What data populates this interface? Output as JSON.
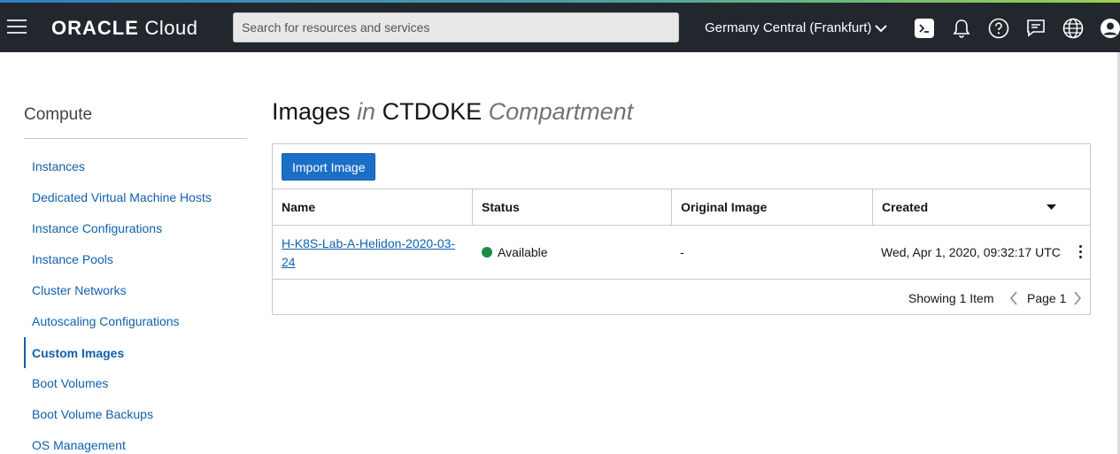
{
  "header": {
    "brand_bold": "ORACLE",
    "brand_light": "Cloud",
    "search_placeholder": "Search for resources and services",
    "region": "Germany Central (Frankfurt)"
  },
  "sidebar": {
    "title": "Compute",
    "items": [
      {
        "label": "Instances"
      },
      {
        "label": "Dedicated Virtual Machine Hosts"
      },
      {
        "label": "Instance Configurations"
      },
      {
        "label": "Instance Pools"
      },
      {
        "label": "Cluster Networks"
      },
      {
        "label": "Autoscaling Configurations"
      },
      {
        "label": "Custom Images",
        "active": true
      },
      {
        "label": "Boot Volumes"
      },
      {
        "label": "Boot Volume Backups"
      },
      {
        "label": "OS Management"
      }
    ]
  },
  "main": {
    "title_prefix": "Images",
    "title_in": "in",
    "title_compartment": "CTDOKE",
    "title_suffix": "Compartment",
    "import_button": "Import Image",
    "columns": [
      "Name",
      "Status",
      "Original Image",
      "Created"
    ],
    "rows": [
      {
        "name": "H-K8S-Lab-A-Helidon-2020-03-24",
        "status": "Available",
        "original_image": "-",
        "created": "Wed, Apr 1, 2020, 09:32:17 UTC"
      }
    ],
    "showing": "Showing 1 Item",
    "page": "Page 1"
  },
  "colors": {
    "topbar": "#22272e",
    "link": "#1160aa",
    "primary_button": "#1c6fc7",
    "status_available": "#1e8b43"
  }
}
